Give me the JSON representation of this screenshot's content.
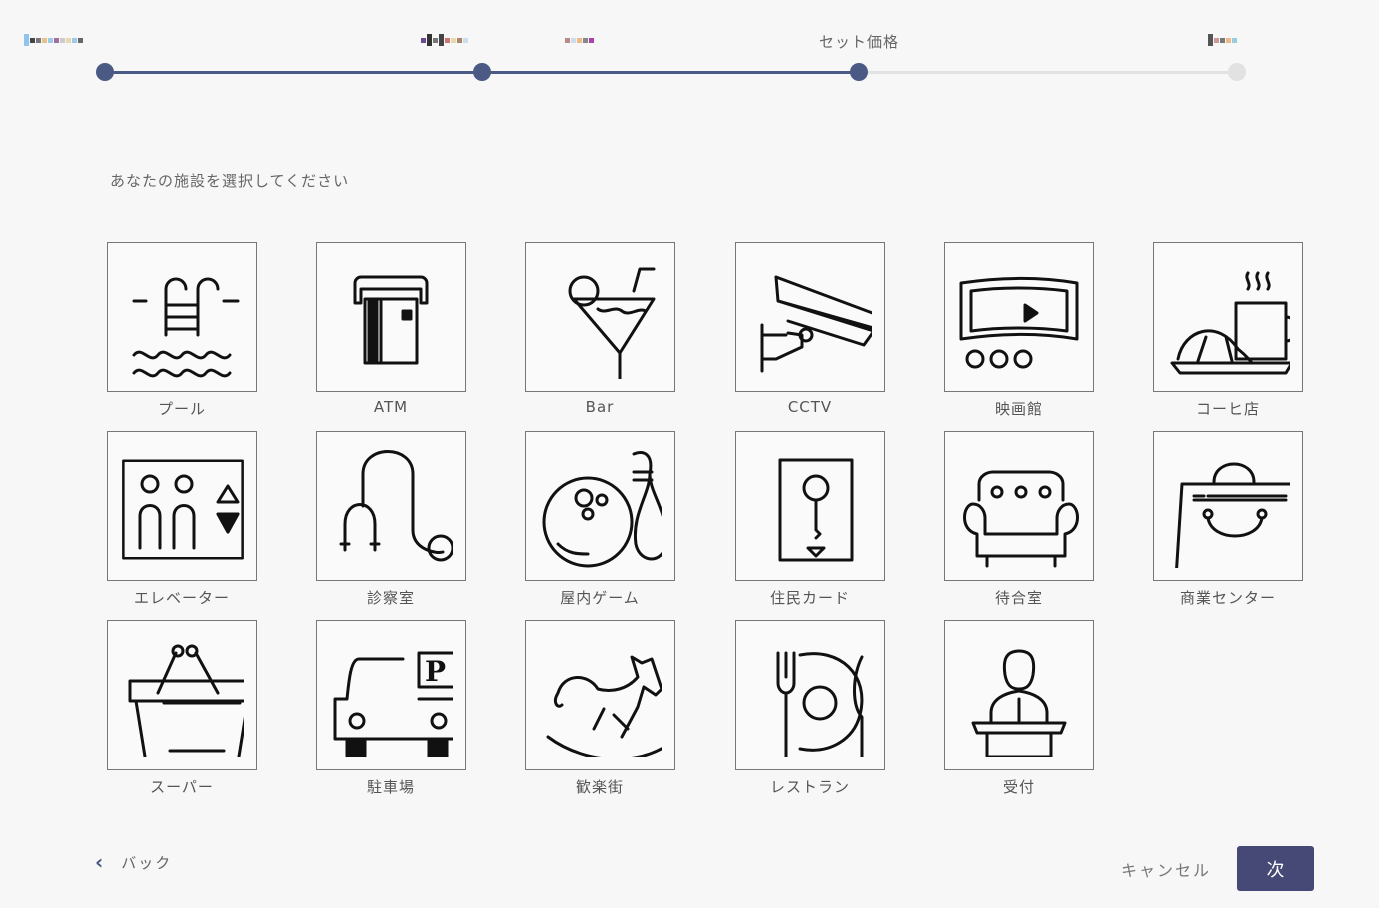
{
  "stepper": {
    "steps": [
      {
        "label": "",
        "state": "done"
      },
      {
        "label": "",
        "state": "done"
      },
      {
        "label": "セット価格",
        "state": "current"
      },
      {
        "label": "",
        "state": "pending"
      }
    ],
    "active_color": "#4a5a85",
    "inactive_color": "#e2e2e2"
  },
  "prompt": "あなたの施設を選択してください",
  "facilities": [
    {
      "label": "プール",
      "icon": "pool-icon"
    },
    {
      "label": "ATM",
      "icon": "atm-icon"
    },
    {
      "label": "Bar",
      "icon": "cocktail-icon"
    },
    {
      "label": "CCTV",
      "icon": "cctv-camera-icon"
    },
    {
      "label": "映画館",
      "icon": "cinema-screen-icon"
    },
    {
      "label": "コーヒ店",
      "icon": "coffee-croissant-icon"
    },
    {
      "label": "エレベーター",
      "icon": "elevator-icon"
    },
    {
      "label": "診察室",
      "icon": "stethoscope-icon"
    },
    {
      "label": "屋内ゲーム",
      "icon": "bowling-icon"
    },
    {
      "label": "住民カード",
      "icon": "key-card-icon"
    },
    {
      "label": "待合室",
      "icon": "sofa-icon"
    },
    {
      "label": "商業センター",
      "icon": "shopping-bag-icon"
    },
    {
      "label": "スーパー",
      "icon": "basket-icon"
    },
    {
      "label": "駐車場",
      "icon": "parking-car-icon"
    },
    {
      "label": "歓楽街",
      "icon": "rocking-horse-icon"
    },
    {
      "label": "レストラン",
      "icon": "restaurant-plate-icon"
    },
    {
      "label": "受付",
      "icon": "reception-desk-icon"
    }
  ],
  "footer": {
    "back_label": "バック",
    "cancel_label": "キャンセル",
    "next_label": "次"
  },
  "colors": {
    "primary_button": "#464875"
  }
}
